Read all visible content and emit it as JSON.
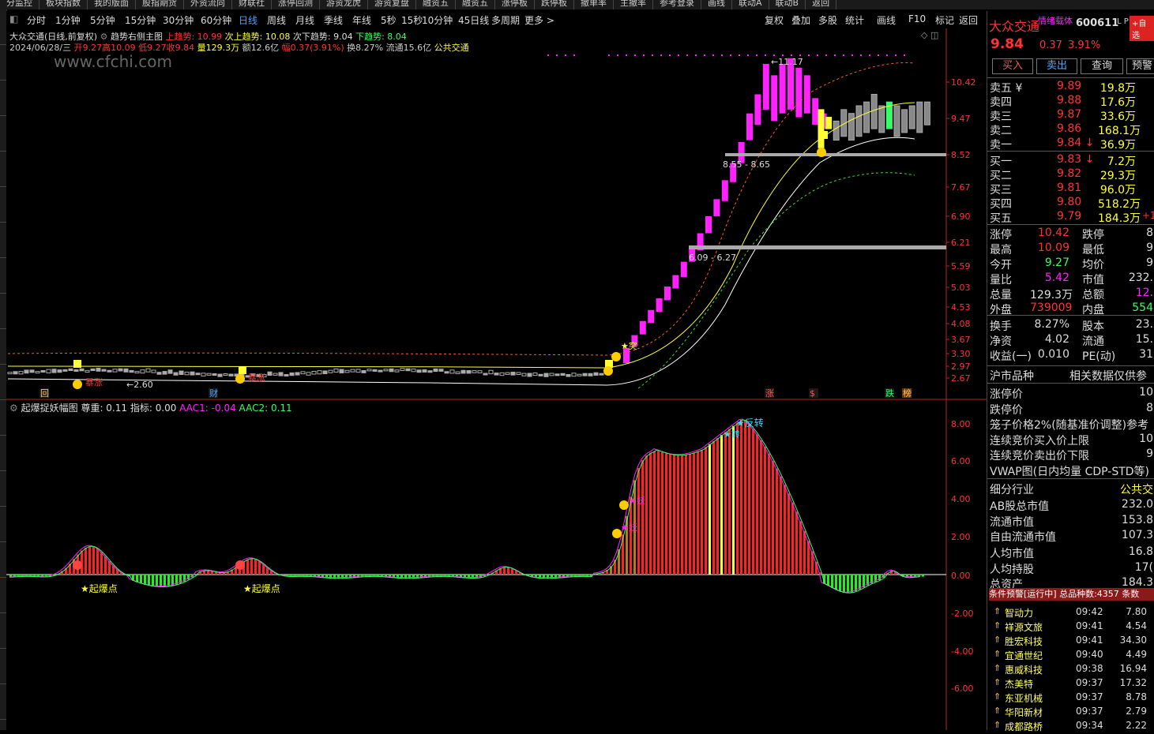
{
  "top_menu": [
    "分监控",
    "板块指数",
    "我的版面",
    "股指期货",
    "外资流向",
    "财联社",
    "涨停回测",
    "游资龙虎",
    "游资复盘",
    "融资五",
    "融资五",
    "涨停板",
    "跌停板",
    "撤单率",
    "主撤率",
    "参考登录",
    "画线",
    "联动A",
    "联动B",
    "返回"
  ],
  "period_bar": {
    "items": [
      "分时",
      "1分钟",
      "5分钟",
      "15分钟",
      "30分钟",
      "60分钟",
      "日线",
      "周线",
      "月线",
      "季线",
      "年线",
      "5秒",
      "15秒",
      "10分钟",
      "45日线",
      "多周期",
      "更多 >"
    ],
    "active": "日线",
    "right_items": [
      "复权",
      "叠加",
      "多股",
      "统计",
      "画线",
      "F10",
      "标记",
      "返回"
    ]
  },
  "main_chart": {
    "title": "大众交通(日线,前复权)",
    "indicator": "趋势右侧主图",
    "up_trend_label": "上趋势: 10.99",
    "sub_up_label": "次上趋势: 10.08",
    "sub_down_label": "次下趋势: 9.04",
    "down_trend_label": "下趋势: 8.04",
    "date": "2024/06/28/三",
    "open": "开9.27",
    "high": "高10.09",
    "low": "低9.27",
    "close": "收9.84",
    "volume": "量129.3万",
    "amount": "额12.6亿",
    "change": "幅0.37(3.91%)",
    "turnover": "换8.27%",
    "float_value": "流通15.6亿",
    "sector": "公共交通",
    "watermark": "www.cfchi.com",
    "price_axis": [
      "10.42",
      "9.47",
      "8.52",
      "7.67",
      "6.90",
      "6.21",
      "5.59",
      "5.03",
      "4.53",
      "4.08",
      "3.67",
      "3.30",
      "2.97",
      "2.67"
    ],
    "annotations": {
      "high_mark": "11.17",
      "low_mark": "2.60",
      "range_upper": "8.55 - 8.65",
      "range_lower": "6.09 - 6.27",
      "tu": "突",
      "baozhang1": "暴涨",
      "baozhang2": "暴涨"
    },
    "bottom_tags": [
      "回",
      "财",
      "涨",
      "$",
      "跌",
      "榜"
    ]
  },
  "sub_chart": {
    "title": "起爆捉妖幅图",
    "weight": "尊重: 0.11",
    "index": "指标: 0.00",
    "aac1": "AAC1: -0.04",
    "aac2": "AAC2: 0.11",
    "axis": [
      "8.00",
      "6.00",
      "4.00",
      "2.00",
      "0.00",
      "-2.00",
      "-4.00",
      "-6.00"
    ],
    "labels": {
      "qibao1": "★起爆点",
      "qibao2": "★起爆点",
      "zhuan1": "反转",
      "zhuan2": "转",
      "yao1": "妖",
      "yao2": "妖"
    }
  },
  "quote": {
    "name": "大众交通",
    "tag": "情绪载体",
    "code": "600611",
    "lp": "L P",
    "add": "+自选",
    "price": "9.84",
    "change": "0.37",
    "pct": "3.91%",
    "buttons": [
      "买入",
      "卖出",
      "查询",
      "预警"
    ],
    "asks": [
      {
        "label": "卖五 ¥",
        "price": "9.89",
        "vol": "19.8万"
      },
      {
        "label": "卖四",
        "price": "9.88",
        "vol": "17.6万"
      },
      {
        "label": "卖三",
        "price": "9.87",
        "vol": "33.6万"
      },
      {
        "label": "卖二",
        "price": "9.86",
        "vol": "168.1万"
      },
      {
        "label": "卖一",
        "price": "9.84 ↓",
        "vol": "36.9万"
      }
    ],
    "bids": [
      {
        "label": "买一",
        "price": "9.83 ↓",
        "vol": "7.2万"
      },
      {
        "label": "买二",
        "price": "9.82",
        "vol": "29.3万"
      },
      {
        "label": "买三",
        "price": "9.81",
        "vol": "96.0万"
      },
      {
        "label": "买四",
        "price": "9.80",
        "vol": "518.2万"
      },
      {
        "label": "买五",
        "price": "9.79",
        "vol": "184.3万"
      }
    ],
    "buy5_extra": "+1",
    "stats": [
      {
        "l1": "涨停",
        "v1": "10.42",
        "l2": "跌停",
        "v2": "8"
      },
      {
        "l1": "最高",
        "v1": "10.09",
        "l2": "最低",
        "v2": "9"
      },
      {
        "l1": "今开",
        "v1": "9.27",
        "l2": "均价",
        "v2": "9"
      },
      {
        "l1": "量比",
        "v1": "5.42",
        "l2": "市值",
        "v2": "232."
      },
      {
        "l1": "总量",
        "v1": "129.3万",
        "l2": "总额",
        "v2": "12."
      },
      {
        "l1": "外盘",
        "v1": "739009",
        "l2": "内盘",
        "v2": "554"
      },
      {
        "l1": "换手",
        "v1": "8.27%",
        "l2": "股本",
        "v2": "23."
      },
      {
        "l1": "净资",
        "v1": "4.02",
        "l2": "流通",
        "v2": "15."
      },
      {
        "l1": "收益(一)",
        "v1": "0.010",
        "l2": "PE(动)",
        "v2": "31"
      }
    ],
    "product_label": "沪市品种",
    "related_label": "相关数据仅供参",
    "extra": [
      {
        "l": "涨停价",
        "v": "10"
      },
      {
        "l": "跌停价",
        "v": "8"
      },
      {
        "l": "笼子价格2%(随基准价调整)参考",
        "v": ""
      },
      {
        "l": "连续竞价买入价上限",
        "v": "10"
      },
      {
        "l": "连续竞价卖出价下限",
        "v": "9"
      },
      {
        "l": "VWAP图(日内均量 CDP-STD等)",
        "v": ""
      }
    ],
    "fund": [
      {
        "l": "细分行业",
        "v": "公共交"
      },
      {
        "l": "AB股总市值",
        "v": "232.0"
      },
      {
        "l": "流通市值",
        "v": "153.8"
      },
      {
        "l": "自由流通市值",
        "v": "107.3"
      },
      {
        "l": "人均市值",
        "v": "16.8"
      },
      {
        "l": "人均持股",
        "v": "17("
      },
      {
        "l": "总资产",
        "v": "184.3"
      }
    ],
    "alert_header": "条件预警[运行中] 总品种数:4357 条数",
    "alerts": [
      {
        "name": "智动力",
        "time": "09:42",
        "price": "7.80"
      },
      {
        "name": "祥源文旅",
        "time": "09:41",
        "price": "4.54"
      },
      {
        "name": "胜宏科技",
        "time": "09:41",
        "price": "34.30"
      },
      {
        "name": "宜通世纪",
        "time": "09:40",
        "price": "4.49"
      },
      {
        "name": "惠威科技",
        "time": "09:38",
        "price": "16.94"
      },
      {
        "name": "杰美特",
        "time": "09:37",
        "price": "17.32"
      },
      {
        "name": "东亚机械",
        "time": "09:37",
        "price": "8.78"
      },
      {
        "name": "华阳新材",
        "time": "09:37",
        "price": "2.79"
      },
      {
        "name": "成都路桥",
        "time": "09:34",
        "price": "2.22"
      }
    ]
  },
  "colors": {
    "up": "#ff3333",
    "down": "#33ff66",
    "magenta": "#ff22ff",
    "yellow": "#ffff33",
    "accent": "#4aa3ff"
  }
}
